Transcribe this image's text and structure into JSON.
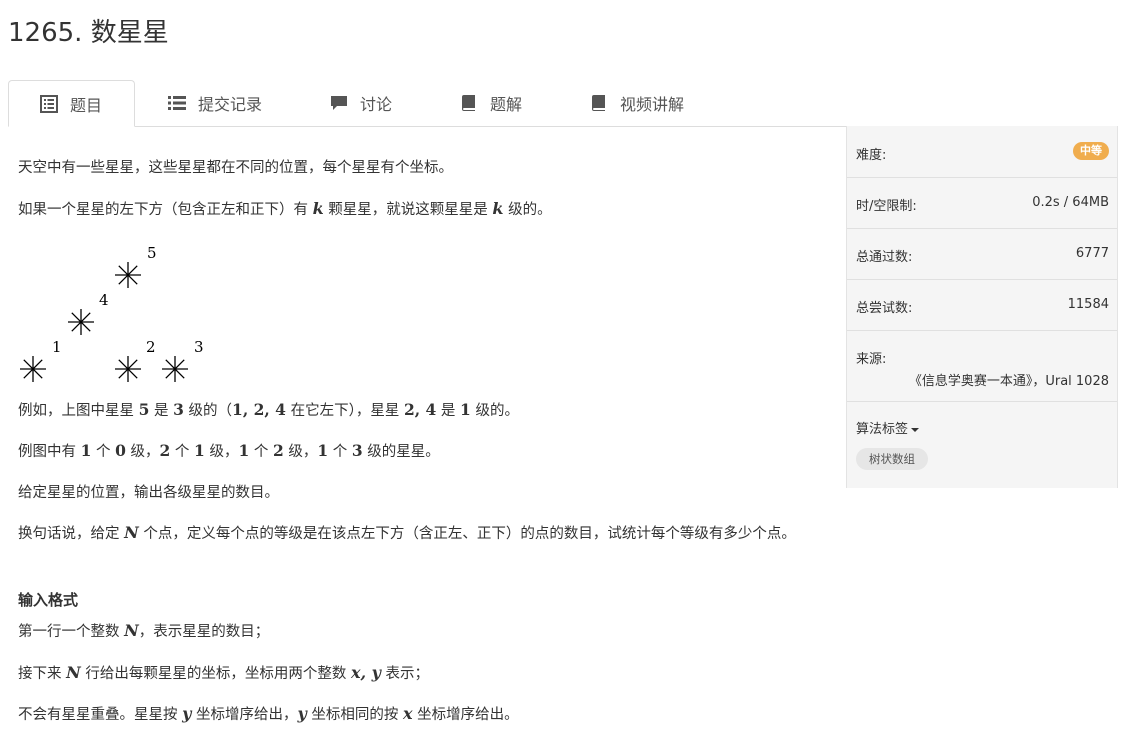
{
  "problem": {
    "title": "1265. 数星星"
  },
  "tabs": [
    {
      "label": "题目",
      "icon": "document-icon",
      "active": true
    },
    {
      "label": "提交记录",
      "icon": "list-icon"
    },
    {
      "label": "讨论",
      "icon": "comment-icon"
    },
    {
      "label": "题解",
      "icon": "book-icon"
    },
    {
      "label": "视频讲解",
      "icon": "book-icon"
    }
  ],
  "desc": {
    "p1": "天空中有一些星星，这些星星都在不同的位置，每个星星有个坐标。",
    "p2_a": "如果一个星星的左下方（包含正左和正下）有 ",
    "p2_k1": "k",
    "p2_b": " 颗星星，就说这颗星星是 ",
    "p2_k2": "k",
    "p2_c": " 级的。",
    "figure_labels": [
      "1",
      "2",
      "3",
      "4",
      "5"
    ],
    "p3_a": "例如，上图中星星 ",
    "p3_n1": "5",
    "p3_b": " 是 ",
    "p3_n2": "3",
    "p3_c": " 级的（",
    "p3_n3": "1, 2, 4",
    "p3_d": " 在它左下），星星 ",
    "p3_n4": "2, 4",
    "p3_e": " 是 ",
    "p3_n5": "1",
    "p3_f": " 级的。",
    "p4_a": "例图中有 ",
    "p4_n1": "1",
    "p4_b": " 个 ",
    "p4_n2": "0",
    "p4_c": " 级，",
    "p4_n3": "2",
    "p4_d": " 个 ",
    "p4_n4": "1",
    "p4_e": " 级，",
    "p4_n5": "1",
    "p4_f": " 个 ",
    "p4_n6": "2",
    "p4_g": " 级，",
    "p4_n7": "1",
    "p4_h": " 个 ",
    "p4_n8": "3",
    "p4_i": " 级的星星。",
    "p5": "给定星星的位置，输出各级星星的数目。",
    "p6_a": "换句话说，给定 ",
    "p6_N": "N",
    "p6_b": " 个点，定义每个点的等级是在该点左下方（含正左、正下）的点的数目，试统计每个等级有多少个点。",
    "input_heading": "输入格式",
    "p7_a": "第一行一个整数 ",
    "p7_N": "N",
    "p7_b": "，表示星星的数目；",
    "p8_a": "接下来 ",
    "p8_N": "N",
    "p8_b": " 行给出每颗星星的坐标，坐标用两个整数 ",
    "p8_xy": "x, y",
    "p8_c": " 表示；",
    "p9_a": "不会有星星重叠。星星按 ",
    "p9_y1": "y",
    "p9_b": " 坐标增序给出，",
    "p9_y2": "y",
    "p9_c": " 坐标相同的按 ",
    "p9_x": "x",
    "p9_d": " 坐标增序给出。"
  },
  "sidebar": {
    "difficulty_label": "难度:",
    "difficulty_value": "中等",
    "difficulty_color": "#f0ad4e",
    "limit_label": "时/空限制:",
    "limit_value": "0.2s / 64MB",
    "passed_label": "总通过数:",
    "passed_value": "6777",
    "tried_label": "总尝试数:",
    "tried_value": "11584",
    "source_label": "来源:",
    "source_value": "《信息学奥赛一本通》，Ural 1028",
    "tags_label": "算法标签",
    "tags": [
      "树状数组"
    ]
  }
}
